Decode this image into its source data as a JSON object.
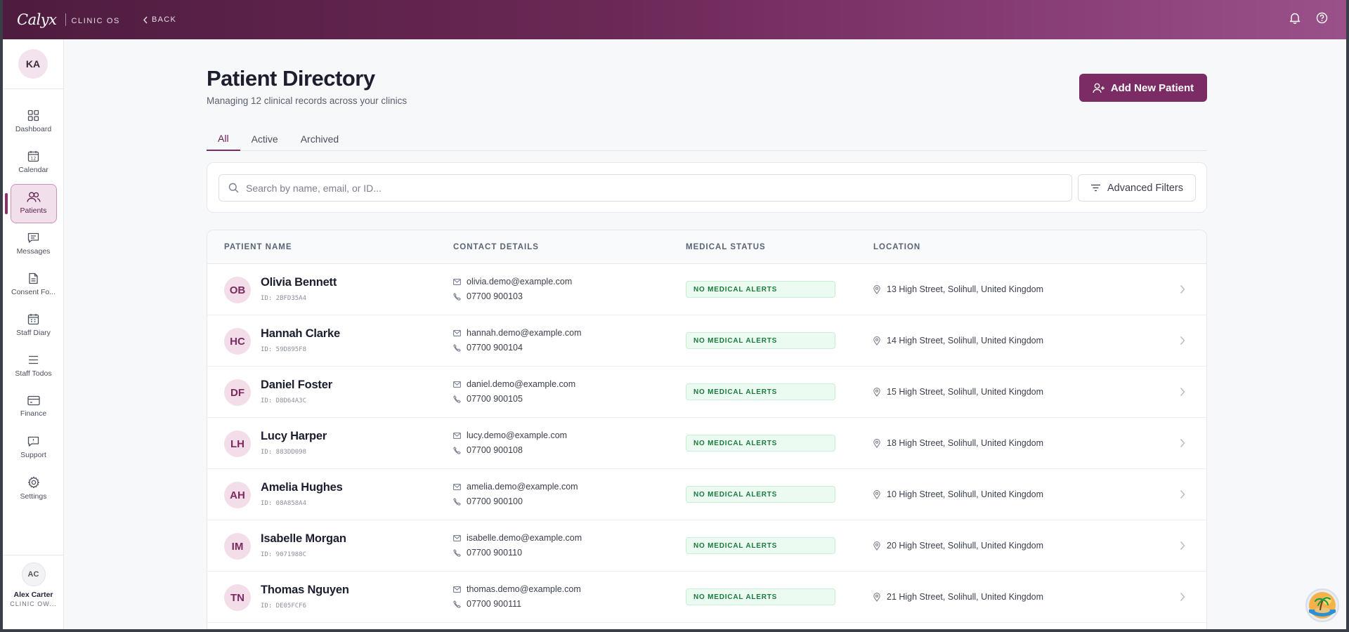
{
  "topbar": {
    "brand": "Calyx",
    "brand_sub": "CLINIC OS",
    "back_label": "BACK"
  },
  "sidebar": {
    "avatar_initials": "KA",
    "items": [
      {
        "label": "Dashboard",
        "icon": "grid-icon"
      },
      {
        "label": "Calendar",
        "icon": "calendar-icon"
      },
      {
        "label": "Patients",
        "icon": "users-icon",
        "active": true
      },
      {
        "label": "Messages",
        "icon": "message-icon"
      },
      {
        "label": "Consent Fo...",
        "icon": "document-icon"
      },
      {
        "label": "Staff Diary",
        "icon": "diary-icon"
      },
      {
        "label": "Staff Todos",
        "icon": "list-icon"
      },
      {
        "label": "Finance",
        "icon": "card-icon"
      },
      {
        "label": "Support",
        "icon": "support-icon"
      },
      {
        "label": "Settings",
        "icon": "gear-icon"
      }
    ],
    "user": {
      "initials": "AC",
      "name": "Alex Carter",
      "role": "CLINIC OW..."
    }
  },
  "header": {
    "title": "Patient Directory",
    "subtitle": "Managing 12 clinical records across your clinics",
    "add_button": "Add New Patient"
  },
  "tabs": [
    {
      "label": "All",
      "active": true
    },
    {
      "label": "Active"
    },
    {
      "label": "Archived"
    }
  ],
  "search": {
    "placeholder": "Search by name, email, or ID...",
    "filter_label": "Advanced Filters"
  },
  "table": {
    "columns": [
      "PATIENT NAME",
      "CONTACT DETAILS",
      "MEDICAL STATUS",
      "LOCATION"
    ],
    "rows": [
      {
        "initials": "OB",
        "name": "Olivia Bennett",
        "id": "ID: 2BFD35A4",
        "email": "olivia.demo@example.com",
        "phone": "07700 900103",
        "status": "NO MEDICAL ALERTS",
        "location": "13 High Street, Solihull, United Kingdom"
      },
      {
        "initials": "HC",
        "name": "Hannah Clarke",
        "id": "ID: 59D895F8",
        "email": "hannah.demo@example.com",
        "phone": "07700 900104",
        "status": "NO MEDICAL ALERTS",
        "location": "14 High Street, Solihull, United Kingdom"
      },
      {
        "initials": "DF",
        "name": "Daniel Foster",
        "id": "ID: D8D64A3C",
        "email": "daniel.demo@example.com",
        "phone": "07700 900105",
        "status": "NO MEDICAL ALERTS",
        "location": "15 High Street, Solihull, United Kingdom"
      },
      {
        "initials": "LH",
        "name": "Lucy Harper",
        "id": "ID: 883DD098",
        "email": "lucy.demo@example.com",
        "phone": "07700 900108",
        "status": "NO MEDICAL ALERTS",
        "location": "18 High Street, Solihull, United Kingdom"
      },
      {
        "initials": "AH",
        "name": "Amelia Hughes",
        "id": "ID: 08A858A4",
        "email": "amelia.demo@example.com",
        "phone": "07700 900100",
        "status": "NO MEDICAL ALERTS",
        "location": "10 High Street, Solihull, United Kingdom"
      },
      {
        "initials": "IM",
        "name": "Isabelle Morgan",
        "id": "ID: 9071988C",
        "email": "isabelle.demo@example.com",
        "phone": "07700 900110",
        "status": "NO MEDICAL ALERTS",
        "location": "20 High Street, Solihull, United Kingdom"
      },
      {
        "initials": "TN",
        "name": "Thomas Nguyen",
        "id": "ID: DE05FCF6",
        "email": "thomas.demo@example.com",
        "phone": "07700 900111",
        "status": "NO MEDICAL ALERTS",
        "location": "21 High Street, Solihull, United Kingdom"
      }
    ]
  },
  "colors": {
    "brand": "#7c2c64",
    "topbar_start": "#4e1c3f",
    "topbar_end": "#9a5189",
    "status_green": "#1a7a3e"
  }
}
